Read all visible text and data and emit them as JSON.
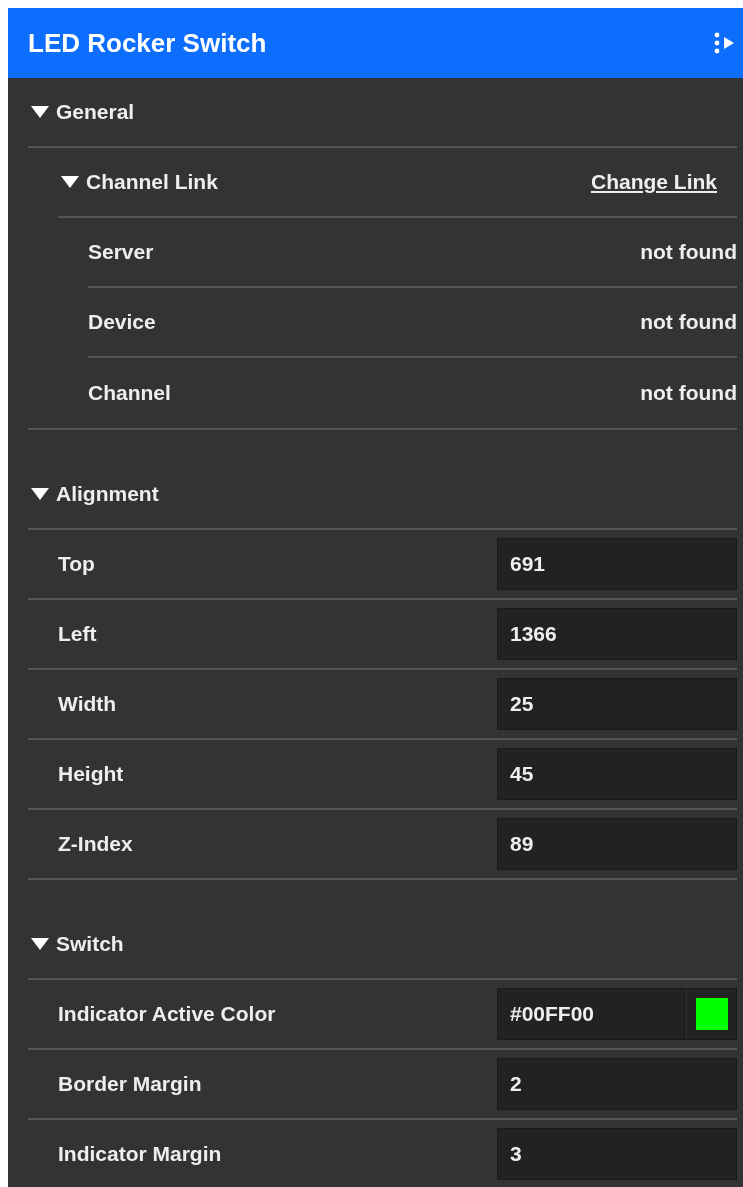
{
  "header": {
    "title": "LED Rocker Switch"
  },
  "sections": [
    {
      "title": "General",
      "expanded": true,
      "subsections": [
        {
          "title": "Channel Link",
          "expanded": true,
          "link": "Change Link",
          "rows": [
            {
              "label": "Server",
              "value": "not found"
            },
            {
              "label": "Device",
              "value": "not found"
            },
            {
              "label": "Channel",
              "value": "not found"
            }
          ]
        }
      ]
    },
    {
      "title": "Alignment",
      "expanded": true,
      "rows": [
        {
          "kind": "number",
          "label": "Top",
          "value": "691"
        },
        {
          "kind": "number",
          "label": "Left",
          "value": "1366"
        },
        {
          "kind": "number",
          "label": "Width",
          "value": "25"
        },
        {
          "kind": "number",
          "label": "Height",
          "value": "45"
        },
        {
          "kind": "number",
          "label": "Z-Index",
          "value": "89"
        }
      ]
    },
    {
      "title": "Switch",
      "expanded": true,
      "rows": [
        {
          "kind": "color",
          "label": "Indicator Active Color",
          "value": "#00FF00"
        },
        {
          "kind": "number",
          "label": "Border Margin",
          "value": "2"
        },
        {
          "kind": "number",
          "label": "Indicator Margin",
          "value": "3"
        }
      ]
    }
  ]
}
